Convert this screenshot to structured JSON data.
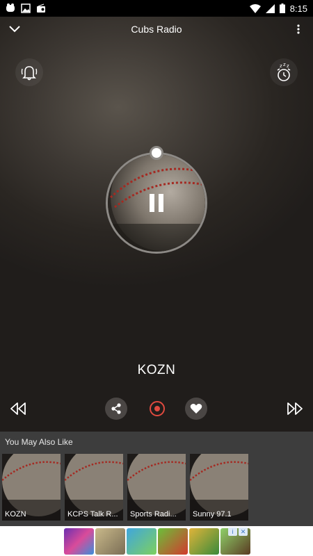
{
  "status_bar": {
    "time": "8:15",
    "left_icons": [
      "notification-icon",
      "image-icon",
      "radio-icon"
    ],
    "right_icons": [
      "wifi-icon",
      "signal-icon",
      "battery-icon"
    ]
  },
  "header": {
    "title": "Cubs Radio",
    "collapse_icon": "chevron-down-icon",
    "menu_icon": "more-vertical-icon"
  },
  "player": {
    "alarm_icon": "bell-icon",
    "sleep_timer_icon": "alarm-clock-zzz-icon",
    "playback_state": "playing",
    "station": "KOZN",
    "controls": {
      "previous_icon": "rewind-icon",
      "share_icon": "share-icon",
      "record_icon": "record-icon",
      "favorite_icon": "heart-icon",
      "next_icon": "fast-forward-icon"
    },
    "accent_color": "#e04a3f"
  },
  "suggestions": {
    "heading": "You May Also Like",
    "items": [
      {
        "label": "KOZN"
      },
      {
        "label": "KCPS Talk R..."
      },
      {
        "label": "Sports Radi..."
      },
      {
        "label": "Sunny 97.1"
      }
    ]
  },
  "ad": {
    "badge_info": "i",
    "badge_close": "✕"
  }
}
